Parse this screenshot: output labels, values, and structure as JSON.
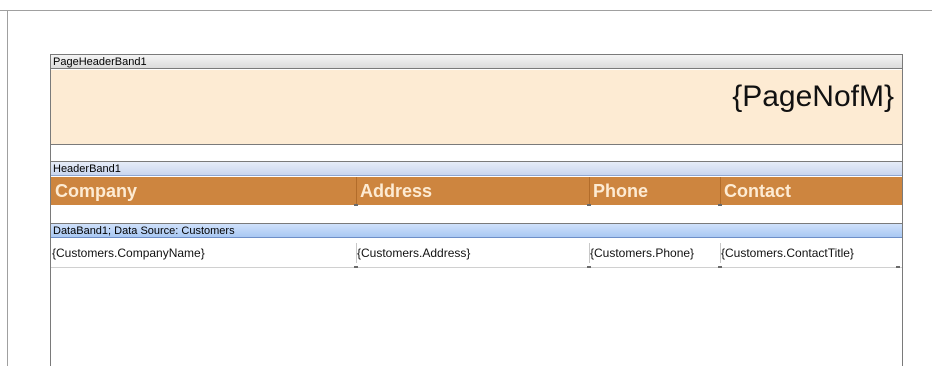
{
  "bands": {
    "page_header": {
      "caption": "PageHeaderBand1",
      "text": "{PageNofM}",
      "fill_color": "#fdebd3"
    },
    "header": {
      "caption": "HeaderBand1",
      "fill_color": "#cd853f",
      "text_color": "#fdebd3",
      "columns": [
        "Company",
        "Address",
        "Phone",
        "Contact"
      ]
    },
    "data": {
      "caption": "DataBand1; Data Source: Customers",
      "fields": [
        "{Customers.CompanyName}",
        "{Customers.Address}",
        "{Customers.Phone}",
        "{Customers.ContactTitle}"
      ]
    }
  }
}
